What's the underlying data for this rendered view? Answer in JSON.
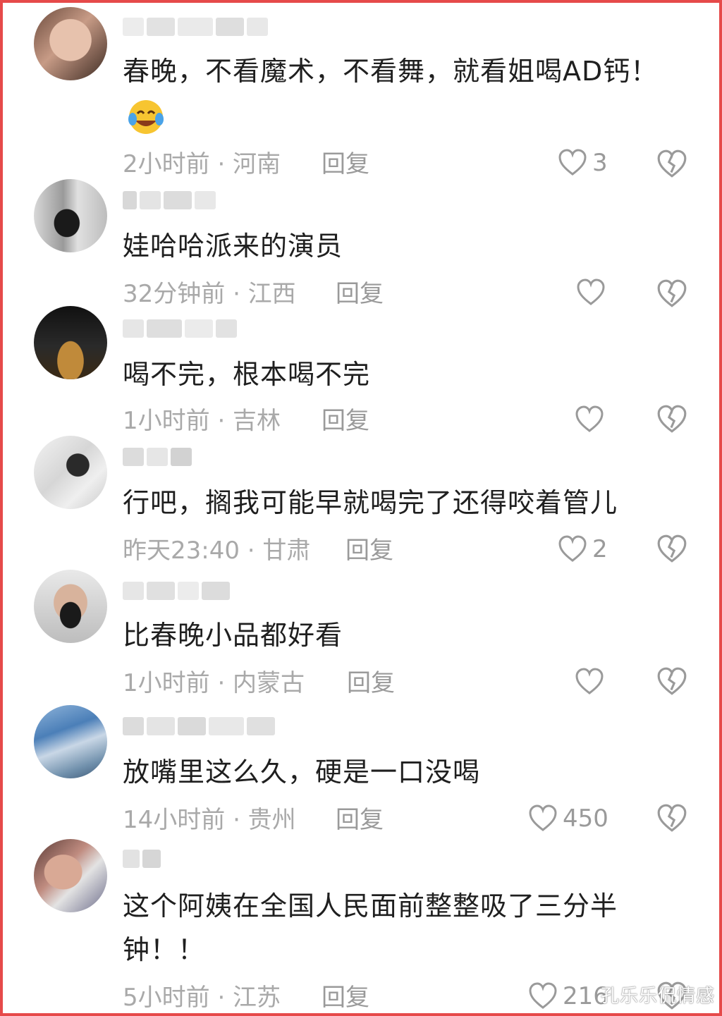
{
  "comments": [
    {
      "text": "春晚，不看魔术，不看舞，就看姐喝AD钙！",
      "emoji_icon": "laughing-crying-emoji",
      "time_location": "2小时前 · 河南",
      "reply_label": "回复",
      "like_count": "3"
    },
    {
      "text": "娃哈哈派来的演员",
      "time_location": "32分钟前 · 江西",
      "reply_label": "回复",
      "like_count": ""
    },
    {
      "text": "喝不完，根本喝不完",
      "time_location": "1小时前 · 吉林",
      "reply_label": "回复",
      "like_count": ""
    },
    {
      "text": "行吧，搁我可能早就喝完了还得咬着管儿",
      "time_location": "昨天23:40 · 甘肃",
      "reply_label": "回复",
      "like_count": "2"
    },
    {
      "text": "比春晚小品都好看",
      "time_location": "1小时前 · 内蒙古",
      "reply_label": "回复",
      "like_count": ""
    },
    {
      "text": "放嘴里这么久，硬是一口没喝",
      "time_location": "14小时前 · 贵州",
      "reply_label": "回复",
      "like_count": "450"
    },
    {
      "text": "这个阿姨在全国人民面前整整吸了三分半钟！！",
      "time_location": "5小时前 · 江苏",
      "reply_label": "回复",
      "like_count": "216"
    }
  ],
  "watermark": "孔乐乐侃情感",
  "colors": {
    "frame_border": "#e64a4a",
    "text": "#1f1f1f",
    "meta": "#a9a9a9",
    "icon": "#9a9a9a"
  },
  "icons": {
    "like": "heart-outline-icon",
    "dislike": "broken-heart-icon"
  }
}
